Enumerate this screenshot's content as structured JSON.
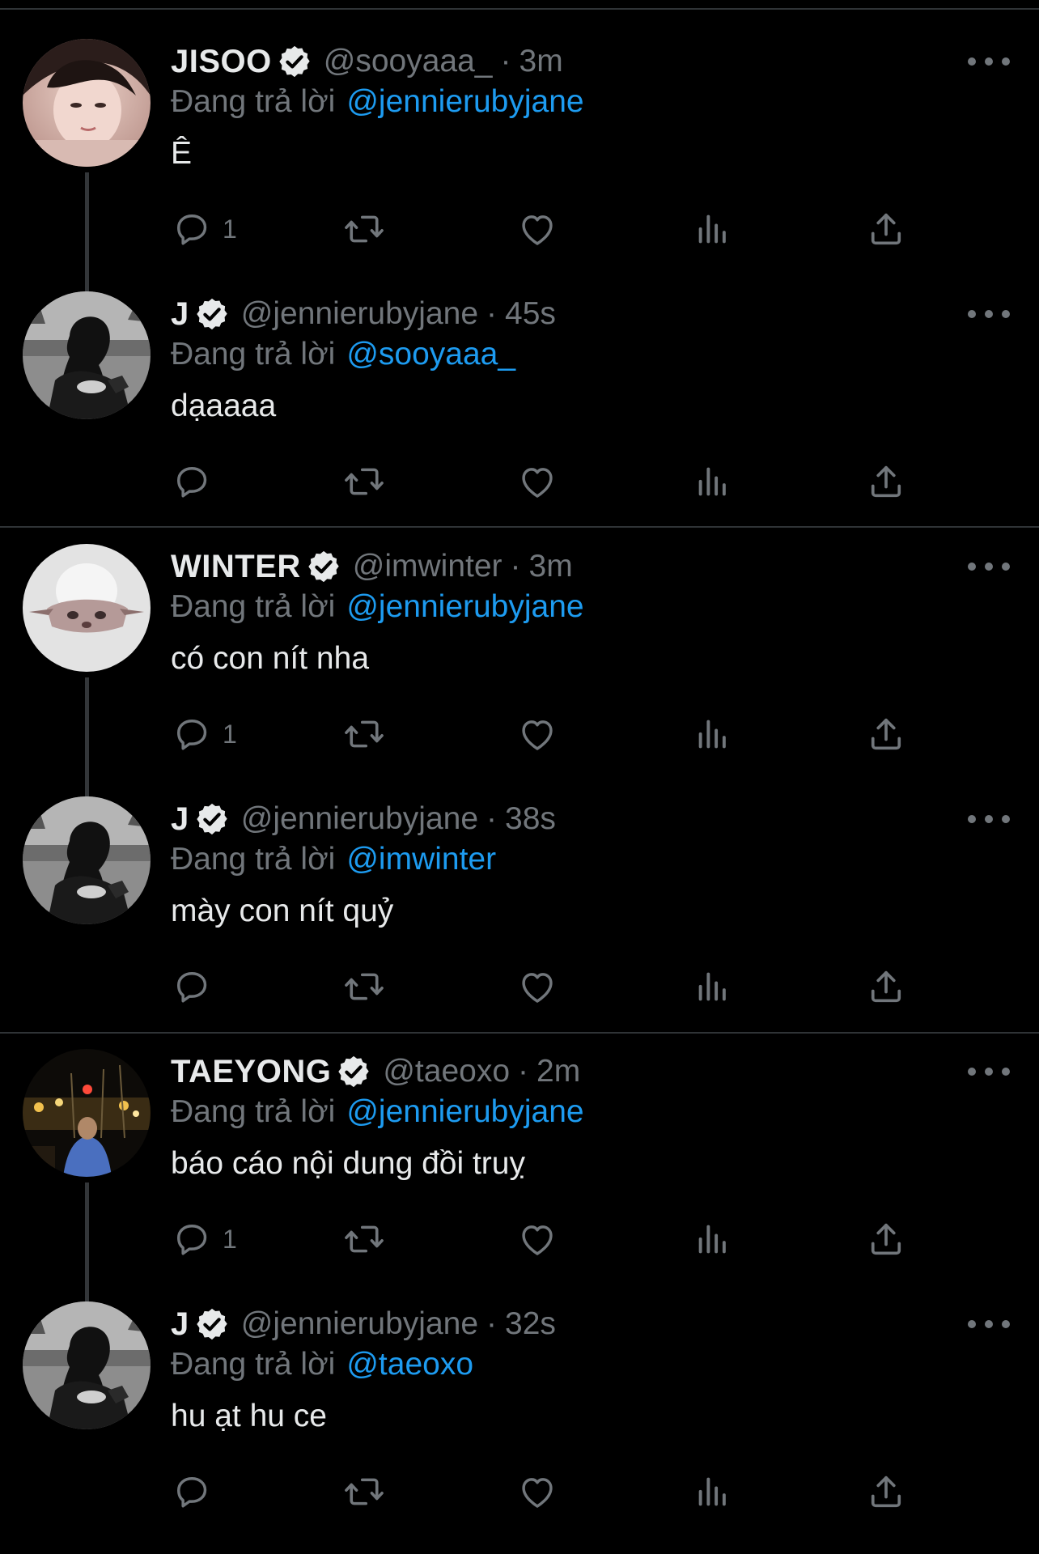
{
  "threads": [
    {
      "tweets": [
        {
          "name": "JISOO",
          "handle": "@sooyaaa_",
          "time": "3m",
          "reply_prefix": "Đang trả lời",
          "reply_to": "@jennierubyjane",
          "text": "Ê",
          "reply_count": "1"
        },
        {
          "name": "J",
          "handle": "@jennierubyjane",
          "time": "45s",
          "reply_prefix": "Đang trả lời",
          "reply_to": "@sooyaaa_",
          "text": "dạaaaa",
          "reply_count": ""
        }
      ]
    },
    {
      "tweets": [
        {
          "name": "WINTER",
          "handle": "@imwinter",
          "time": "3m",
          "reply_prefix": "Đang trả lời",
          "reply_to": "@jennierubyjane",
          "text": "có con nít nha",
          "reply_count": "1"
        },
        {
          "name": "J",
          "handle": "@jennierubyjane",
          "time": "38s",
          "reply_prefix": "Đang trả lời",
          "reply_to": "@imwinter",
          "text": "mày con nít quỷ",
          "reply_count": ""
        }
      ]
    },
    {
      "tweets": [
        {
          "name": "TAEYONG",
          "handle": "@taeoxo",
          "time": "2m",
          "reply_prefix": "Đang trả lời",
          "reply_to": "@jennierubyjane",
          "text": "báo cáo nội dung đồi truỵ",
          "reply_count": "1"
        },
        {
          "name": "J",
          "handle": "@jennierubyjane",
          "time": "32s",
          "reply_prefix": "Đang trả lời",
          "reply_to": "@taeoxo",
          "text": "hu ạt hu ce",
          "reply_count": ""
        }
      ]
    }
  ],
  "separator": "·",
  "colors": {
    "background": "#000000",
    "text": "#e7e9ea",
    "muted": "#71767b",
    "accent": "#1d9bf0",
    "divider": "#2f3336"
  },
  "icons": {
    "verified": "verified-badge-icon",
    "more": "more-dots-icon",
    "reply": "reply-icon",
    "retweet": "retweet-icon",
    "like": "heart-icon",
    "views": "views-icon",
    "share": "share-icon"
  }
}
